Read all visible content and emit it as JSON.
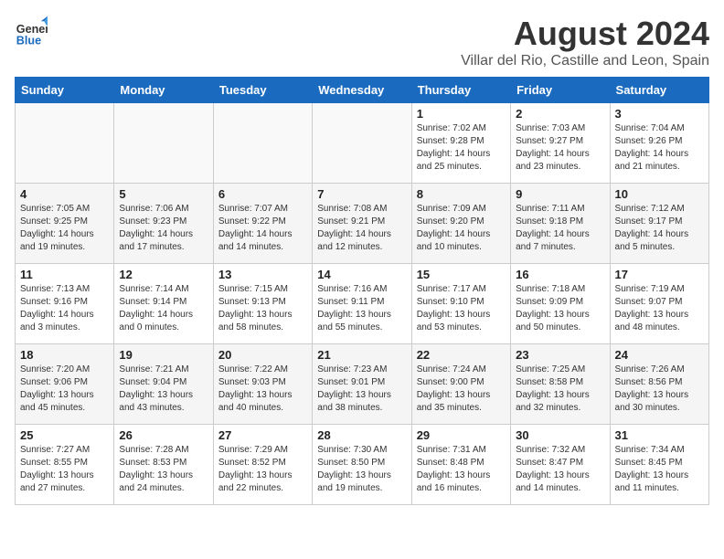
{
  "header": {
    "month": "August 2024",
    "location": "Villar del Rio, Castille and Leon, Spain",
    "logo_general": "General",
    "logo_blue": "Blue"
  },
  "days_of_week": [
    "Sunday",
    "Monday",
    "Tuesday",
    "Wednesday",
    "Thursday",
    "Friday",
    "Saturday"
  ],
  "weeks": [
    [
      {
        "num": "",
        "sunrise": "",
        "sunset": "",
        "daylight": ""
      },
      {
        "num": "",
        "sunrise": "",
        "sunset": "",
        "daylight": ""
      },
      {
        "num": "",
        "sunrise": "",
        "sunset": "",
        "daylight": ""
      },
      {
        "num": "",
        "sunrise": "",
        "sunset": "",
        "daylight": ""
      },
      {
        "num": "1",
        "sunrise": "Sunrise: 7:02 AM",
        "sunset": "Sunset: 9:28 PM",
        "daylight": "Daylight: 14 hours and 25 minutes."
      },
      {
        "num": "2",
        "sunrise": "Sunrise: 7:03 AM",
        "sunset": "Sunset: 9:27 PM",
        "daylight": "Daylight: 14 hours and 23 minutes."
      },
      {
        "num": "3",
        "sunrise": "Sunrise: 7:04 AM",
        "sunset": "Sunset: 9:26 PM",
        "daylight": "Daylight: 14 hours and 21 minutes."
      }
    ],
    [
      {
        "num": "4",
        "sunrise": "Sunrise: 7:05 AM",
        "sunset": "Sunset: 9:25 PM",
        "daylight": "Daylight: 14 hours and 19 minutes."
      },
      {
        "num": "5",
        "sunrise": "Sunrise: 7:06 AM",
        "sunset": "Sunset: 9:23 PM",
        "daylight": "Daylight: 14 hours and 17 minutes."
      },
      {
        "num": "6",
        "sunrise": "Sunrise: 7:07 AM",
        "sunset": "Sunset: 9:22 PM",
        "daylight": "Daylight: 14 hours and 14 minutes."
      },
      {
        "num": "7",
        "sunrise": "Sunrise: 7:08 AM",
        "sunset": "Sunset: 9:21 PM",
        "daylight": "Daylight: 14 hours and 12 minutes."
      },
      {
        "num": "8",
        "sunrise": "Sunrise: 7:09 AM",
        "sunset": "Sunset: 9:20 PM",
        "daylight": "Daylight: 14 hours and 10 minutes."
      },
      {
        "num": "9",
        "sunrise": "Sunrise: 7:11 AM",
        "sunset": "Sunset: 9:18 PM",
        "daylight": "Daylight: 14 hours and 7 minutes."
      },
      {
        "num": "10",
        "sunrise": "Sunrise: 7:12 AM",
        "sunset": "Sunset: 9:17 PM",
        "daylight": "Daylight: 14 hours and 5 minutes."
      }
    ],
    [
      {
        "num": "11",
        "sunrise": "Sunrise: 7:13 AM",
        "sunset": "Sunset: 9:16 PM",
        "daylight": "Daylight: 14 hours and 3 minutes."
      },
      {
        "num": "12",
        "sunrise": "Sunrise: 7:14 AM",
        "sunset": "Sunset: 9:14 PM",
        "daylight": "Daylight: 14 hours and 0 minutes."
      },
      {
        "num": "13",
        "sunrise": "Sunrise: 7:15 AM",
        "sunset": "Sunset: 9:13 PM",
        "daylight": "Daylight: 13 hours and 58 minutes."
      },
      {
        "num": "14",
        "sunrise": "Sunrise: 7:16 AM",
        "sunset": "Sunset: 9:11 PM",
        "daylight": "Daylight: 13 hours and 55 minutes."
      },
      {
        "num": "15",
        "sunrise": "Sunrise: 7:17 AM",
        "sunset": "Sunset: 9:10 PM",
        "daylight": "Daylight: 13 hours and 53 minutes."
      },
      {
        "num": "16",
        "sunrise": "Sunrise: 7:18 AM",
        "sunset": "Sunset: 9:09 PM",
        "daylight": "Daylight: 13 hours and 50 minutes."
      },
      {
        "num": "17",
        "sunrise": "Sunrise: 7:19 AM",
        "sunset": "Sunset: 9:07 PM",
        "daylight": "Daylight: 13 hours and 48 minutes."
      }
    ],
    [
      {
        "num": "18",
        "sunrise": "Sunrise: 7:20 AM",
        "sunset": "Sunset: 9:06 PM",
        "daylight": "Daylight: 13 hours and 45 minutes."
      },
      {
        "num": "19",
        "sunrise": "Sunrise: 7:21 AM",
        "sunset": "Sunset: 9:04 PM",
        "daylight": "Daylight: 13 hours and 43 minutes."
      },
      {
        "num": "20",
        "sunrise": "Sunrise: 7:22 AM",
        "sunset": "Sunset: 9:03 PM",
        "daylight": "Daylight: 13 hours and 40 minutes."
      },
      {
        "num": "21",
        "sunrise": "Sunrise: 7:23 AM",
        "sunset": "Sunset: 9:01 PM",
        "daylight": "Daylight: 13 hours and 38 minutes."
      },
      {
        "num": "22",
        "sunrise": "Sunrise: 7:24 AM",
        "sunset": "Sunset: 9:00 PM",
        "daylight": "Daylight: 13 hours and 35 minutes."
      },
      {
        "num": "23",
        "sunrise": "Sunrise: 7:25 AM",
        "sunset": "Sunset: 8:58 PM",
        "daylight": "Daylight: 13 hours and 32 minutes."
      },
      {
        "num": "24",
        "sunrise": "Sunrise: 7:26 AM",
        "sunset": "Sunset: 8:56 PM",
        "daylight": "Daylight: 13 hours and 30 minutes."
      }
    ],
    [
      {
        "num": "25",
        "sunrise": "Sunrise: 7:27 AM",
        "sunset": "Sunset: 8:55 PM",
        "daylight": "Daylight: 13 hours and 27 minutes."
      },
      {
        "num": "26",
        "sunrise": "Sunrise: 7:28 AM",
        "sunset": "Sunset: 8:53 PM",
        "daylight": "Daylight: 13 hours and 24 minutes."
      },
      {
        "num": "27",
        "sunrise": "Sunrise: 7:29 AM",
        "sunset": "Sunset: 8:52 PM",
        "daylight": "Daylight: 13 hours and 22 minutes."
      },
      {
        "num": "28",
        "sunrise": "Sunrise: 7:30 AM",
        "sunset": "Sunset: 8:50 PM",
        "daylight": "Daylight: 13 hours and 19 minutes."
      },
      {
        "num": "29",
        "sunrise": "Sunrise: 7:31 AM",
        "sunset": "Sunset: 8:48 PM",
        "daylight": "Daylight: 13 hours and 16 minutes."
      },
      {
        "num": "30",
        "sunrise": "Sunrise: 7:32 AM",
        "sunset": "Sunset: 8:47 PM",
        "daylight": "Daylight: 13 hours and 14 minutes."
      },
      {
        "num": "31",
        "sunrise": "Sunrise: 7:34 AM",
        "sunset": "Sunset: 8:45 PM",
        "daylight": "Daylight: 13 hours and 11 minutes."
      }
    ]
  ]
}
